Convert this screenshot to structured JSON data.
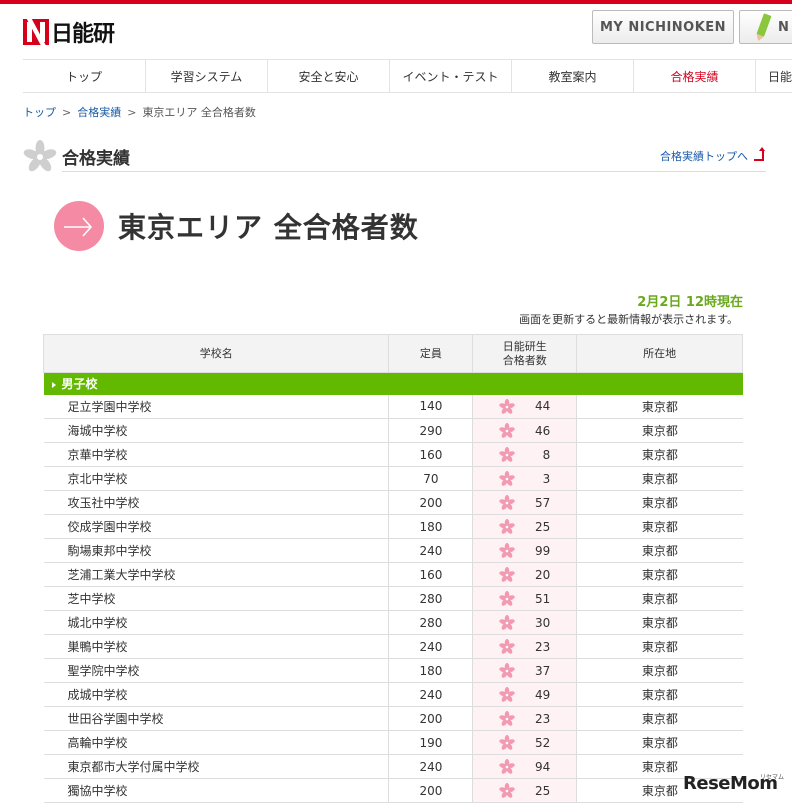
{
  "logo": {
    "text": "日能研"
  },
  "top_buttons": {
    "my_nichinoken": "MY NICHINOKEN",
    "second": "N"
  },
  "gnav": [
    {
      "label": "トップ"
    },
    {
      "label": "学習システム"
    },
    {
      "label": "安全と安心"
    },
    {
      "label": "イベント・テスト"
    },
    {
      "label": "教室案内"
    },
    {
      "label": "合格実績",
      "active": true
    },
    {
      "label": "日能"
    }
  ],
  "breadcrumb": {
    "home": "トップ",
    "parent": "合格実績",
    "current": "東京エリア 全合格者数"
  },
  "section": {
    "title": "合格実績",
    "link": "合格実績トップへ"
  },
  "page_title": "東京エリア 全合格者数",
  "update": {
    "time": "2月2日 12時現在",
    "note": "画面を更新すると最新情報が表示されます。"
  },
  "table": {
    "headers": {
      "name": "学校名",
      "capacity": "定員",
      "passed_line1": "日能研生",
      "passed_line2": "合格者数",
      "location": "所在地"
    },
    "category": "男子校",
    "rows": [
      {
        "name": "足立学園中学校",
        "capacity": "140",
        "passed": "44",
        "location": "東京都"
      },
      {
        "name": "海城中学校",
        "capacity": "290",
        "passed": "46",
        "location": "東京都"
      },
      {
        "name": "京華中学校",
        "capacity": "160",
        "passed": "8",
        "location": "東京都"
      },
      {
        "name": "京北中学校",
        "capacity": "70",
        "passed": "3",
        "location": "東京都"
      },
      {
        "name": "攻玉社中学校",
        "capacity": "200",
        "passed": "57",
        "location": "東京都"
      },
      {
        "name": "佼成学園中学校",
        "capacity": "180",
        "passed": "25",
        "location": "東京都"
      },
      {
        "name": "駒場東邦中学校",
        "capacity": "240",
        "passed": "99",
        "location": "東京都"
      },
      {
        "name": "芝浦工業大学中学校",
        "capacity": "160",
        "passed": "20",
        "location": "東京都"
      },
      {
        "name": "芝中学校",
        "capacity": "280",
        "passed": "51",
        "location": "東京都"
      },
      {
        "name": "城北中学校",
        "capacity": "280",
        "passed": "30",
        "location": "東京都"
      },
      {
        "name": "巣鴨中学校",
        "capacity": "240",
        "passed": "23",
        "location": "東京都"
      },
      {
        "name": "聖学院中学校",
        "capacity": "180",
        "passed": "37",
        "location": "東京都"
      },
      {
        "name": "成城中学校",
        "capacity": "240",
        "passed": "49",
        "location": "東京都"
      },
      {
        "name": "世田谷学園中学校",
        "capacity": "200",
        "passed": "23",
        "location": "東京都"
      },
      {
        "name": "高輪中学校",
        "capacity": "190",
        "passed": "52",
        "location": "東京都"
      },
      {
        "name": "東京都市大学付属中学校",
        "capacity": "240",
        "passed": "94",
        "location": "東京都"
      },
      {
        "name": "獨協中学校",
        "capacity": "200",
        "passed": "25",
        "location": "東京都"
      }
    ]
  },
  "watermark": {
    "text": "ReseMom",
    "sub": "リセマム"
  },
  "colors": {
    "brand_red": "#d6001c",
    "category_green": "#63b900",
    "update_green": "#6aa81e",
    "link_blue": "#1a5aa8",
    "accent_pink": "#f48aa3"
  }
}
